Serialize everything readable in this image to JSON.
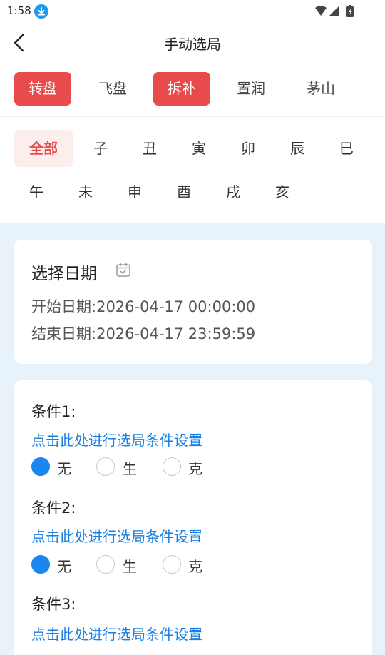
{
  "status_bar": {
    "time": "1:58"
  },
  "header": {
    "title": "手动选局"
  },
  "tabs": [
    {
      "label": "转盘",
      "active": true
    },
    {
      "label": "飞盘",
      "active": false
    },
    {
      "label": "拆补",
      "active": true
    },
    {
      "label": "置润",
      "active": false
    },
    {
      "label": "茅山",
      "active": false
    }
  ],
  "branches": [
    {
      "label": "全部",
      "active": true
    },
    {
      "label": "子"
    },
    {
      "label": "丑"
    },
    {
      "label": "寅"
    },
    {
      "label": "卯"
    },
    {
      "label": "辰"
    },
    {
      "label": "巳"
    },
    {
      "label": "午"
    },
    {
      "label": "未"
    },
    {
      "label": "申"
    },
    {
      "label": "酉"
    },
    {
      "label": "戌"
    },
    {
      "label": "亥"
    }
  ],
  "date_card": {
    "title": "选择日期",
    "start_label": "开始日期:",
    "start_value": "2026-04-17 00:00:00",
    "end_label": "结束日期:",
    "end_value": "2026-04-17 23:59:59"
  },
  "conditions": [
    {
      "label": "条件1:",
      "link": "点击此处进行选局条件设置",
      "options": [
        "无",
        "生",
        "克"
      ],
      "selected": 0
    },
    {
      "label": "条件2:",
      "link": "点击此处进行选局条件设置",
      "options": [
        "无",
        "生",
        "克"
      ],
      "selected": 0
    },
    {
      "label": "条件3:",
      "link": "点击此处进行选局条件设置"
    }
  ],
  "colors": {
    "accent_red": "#e84b4b",
    "accent_blue": "#1a86f0",
    "link_blue": "#1a7fe0",
    "page_bg": "#e8f2fb"
  }
}
